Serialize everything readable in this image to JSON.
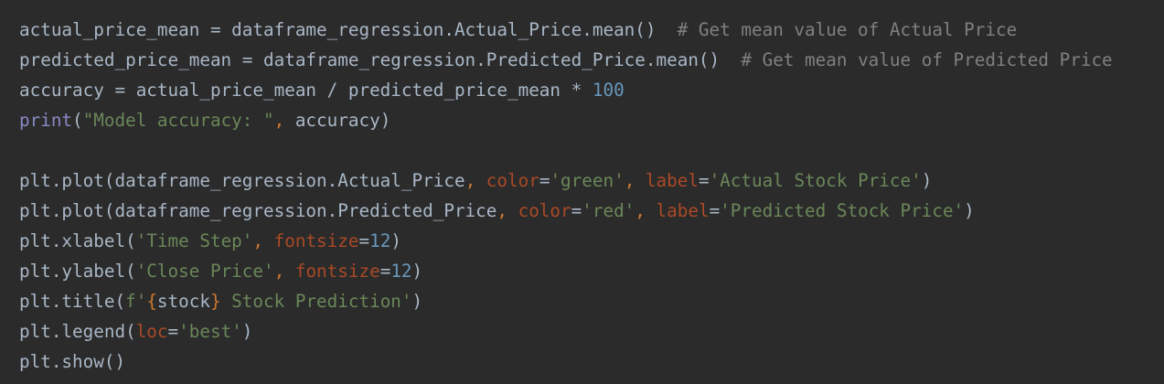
{
  "editor": {
    "language": "python",
    "theme": "darcula",
    "colors": {
      "background": "#2b2b2b",
      "plain": "#a9b7c6",
      "comment": "#808080",
      "number": "#6897bb",
      "string": "#6a8759",
      "builtin": "#8888c6",
      "param": "#aa4926",
      "comma": "#cc7832"
    },
    "lines": [
      [
        {
          "t": "actual_price_mean = dataframe_regression.Actual_Price.mean()  ",
          "k": "plain"
        },
        {
          "t": "# Get mean value of Actual Price",
          "k": "comment"
        }
      ],
      [
        {
          "t": "predicted_price_mean = dataframe_regression.Predicted_Price.mean()  ",
          "k": "plain"
        },
        {
          "t": "# Get mean value of Predicted Price",
          "k": "comment"
        }
      ],
      [
        {
          "t": "accuracy = actual_price_mean / predicted_price_mean * ",
          "k": "plain"
        },
        {
          "t": "100",
          "k": "number"
        }
      ],
      [
        {
          "t": "print",
          "k": "builtin"
        },
        {
          "t": "(",
          "k": "plain"
        },
        {
          "t": "\"Model accuracy: \"",
          "k": "string"
        },
        {
          "t": ", ",
          "k": "comma"
        },
        {
          "t": "accuracy)",
          "k": "plain"
        }
      ],
      [],
      [
        {
          "t": "plt.plot(dataframe_regression.Actual_Price",
          "k": "plain"
        },
        {
          "t": ", ",
          "k": "comma"
        },
        {
          "t": "color",
          "k": "param"
        },
        {
          "t": "=",
          "k": "plain"
        },
        {
          "t": "'green'",
          "k": "string"
        },
        {
          "t": ", ",
          "k": "comma"
        },
        {
          "t": "label",
          "k": "param"
        },
        {
          "t": "=",
          "k": "plain"
        },
        {
          "t": "'Actual Stock Price'",
          "k": "string"
        },
        {
          "t": ")",
          "k": "plain"
        }
      ],
      [
        {
          "t": "plt.plot(dataframe_regression.Predicted_Price",
          "k": "plain"
        },
        {
          "t": ", ",
          "k": "comma"
        },
        {
          "t": "color",
          "k": "param"
        },
        {
          "t": "=",
          "k": "plain"
        },
        {
          "t": "'red'",
          "k": "string"
        },
        {
          "t": ", ",
          "k": "comma"
        },
        {
          "t": "label",
          "k": "param"
        },
        {
          "t": "=",
          "k": "plain"
        },
        {
          "t": "'Predicted Stock Price'",
          "k": "string"
        },
        {
          "t": ")",
          "k": "plain"
        }
      ],
      [
        {
          "t": "plt.xlabel(",
          "k": "plain"
        },
        {
          "t": "'Time Step'",
          "k": "string"
        },
        {
          "t": ", ",
          "k": "comma"
        },
        {
          "t": "fontsize",
          "k": "param"
        },
        {
          "t": "=",
          "k": "plain"
        },
        {
          "t": "12",
          "k": "number"
        },
        {
          "t": ")",
          "k": "plain"
        }
      ],
      [
        {
          "t": "plt.ylabel(",
          "k": "plain"
        },
        {
          "t": "'Close Price'",
          "k": "string"
        },
        {
          "t": ", ",
          "k": "comma"
        },
        {
          "t": "fontsize",
          "k": "param"
        },
        {
          "t": "=",
          "k": "plain"
        },
        {
          "t": "12",
          "k": "number"
        },
        {
          "t": ")",
          "k": "plain"
        }
      ],
      [
        {
          "t": "plt.title(",
          "k": "plain"
        },
        {
          "t": "f'",
          "k": "string"
        },
        {
          "t": "{",
          "k": "fbrace"
        },
        {
          "t": "stock",
          "k": "plain"
        },
        {
          "t": "}",
          "k": "fbrace"
        },
        {
          "t": " Stock Prediction'",
          "k": "string"
        },
        {
          "t": ")",
          "k": "plain"
        }
      ],
      [
        {
          "t": "plt.legend(",
          "k": "plain"
        },
        {
          "t": "loc",
          "k": "param"
        },
        {
          "t": "=",
          "k": "plain"
        },
        {
          "t": "'best'",
          "k": "string"
        },
        {
          "t": ")",
          "k": "plain"
        }
      ],
      [
        {
          "t": "plt.show()",
          "k": "plain"
        }
      ]
    ]
  }
}
